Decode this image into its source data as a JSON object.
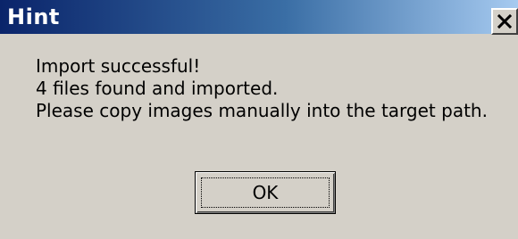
{
  "window": {
    "title": "Hint",
    "close_icon": "close-x-icon"
  },
  "message": {
    "lines": [
      "Import successful!",
      "4 files found and imported.",
      "Please copy images manually into the target path."
    ]
  },
  "buttons": {
    "ok_label": "OK"
  },
  "colors": {
    "dialog_background": "#d4d0c8",
    "title_gradient_start": "#0a246a",
    "title_gradient_end": "#a6caf0",
    "title_text": "#ffffff"
  }
}
